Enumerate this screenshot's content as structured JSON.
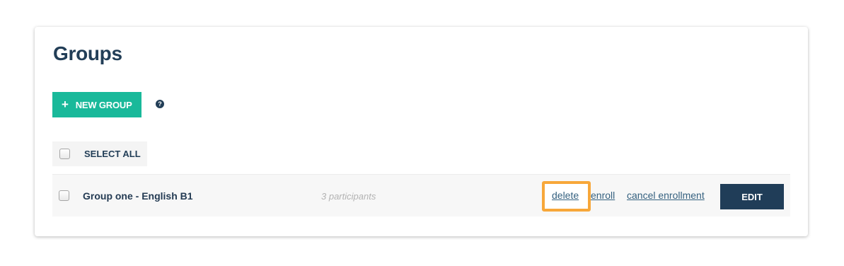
{
  "page": {
    "title": "Groups"
  },
  "toolbar": {
    "new_group_label": "NEW GROUP",
    "plus_icon": "+",
    "help_icon": "?"
  },
  "select_all": {
    "label": "SELECT ALL",
    "checked": false
  },
  "groups": [
    {
      "name": "Group one - English B1",
      "participants": "3 participants",
      "checked": false,
      "actions": {
        "delete": "delete",
        "enroll": "enroll",
        "cancel_enrollment": "cancel enrollment"
      },
      "edit_label": "EDIT"
    }
  ],
  "colors": {
    "accent_green": "#19b99a",
    "navy": "#203d58",
    "highlight_orange": "#f7a73a",
    "link": "#34607f"
  }
}
